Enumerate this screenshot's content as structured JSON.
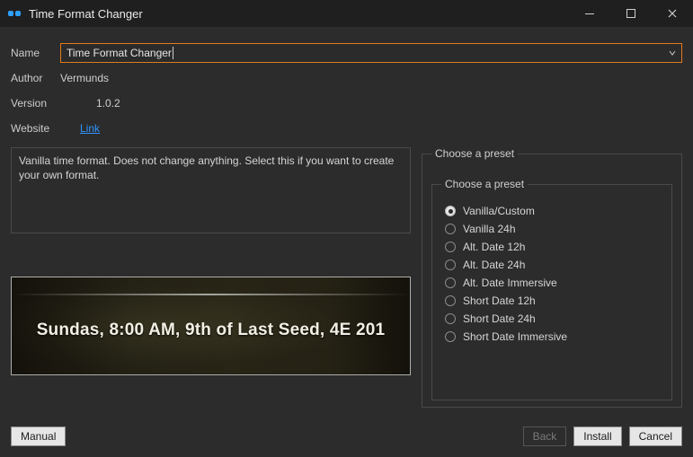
{
  "window": {
    "title": "Time Format Changer"
  },
  "meta": {
    "name_label": "Name",
    "name_value": "Time Format Changer",
    "author_label": "Author",
    "author_value": "Vermunds",
    "version_label": "Version",
    "version_value": "1.0.2",
    "website_label": "Website",
    "website_link_text": "Link"
  },
  "description": "Vanilla time format. Does not change anything. Select this if you want to create your own format.",
  "preview_text": "Sundas, 8:00 AM, 9th of Last Seed, 4E 201",
  "preset": {
    "outer_legend": "Choose a preset",
    "inner_legend": "Choose a preset",
    "options": [
      "Vanilla/Custom",
      "Vanilla 24h",
      "Alt. Date 12h",
      "Alt. Date 24h",
      "Alt. Date Immersive",
      "Short Date 12h",
      "Short Date 24h",
      "Short Date Immersive"
    ],
    "selected_index": 0
  },
  "buttons": {
    "manual": "Manual",
    "back": "Back",
    "install": "Install",
    "cancel": "Cancel"
  }
}
